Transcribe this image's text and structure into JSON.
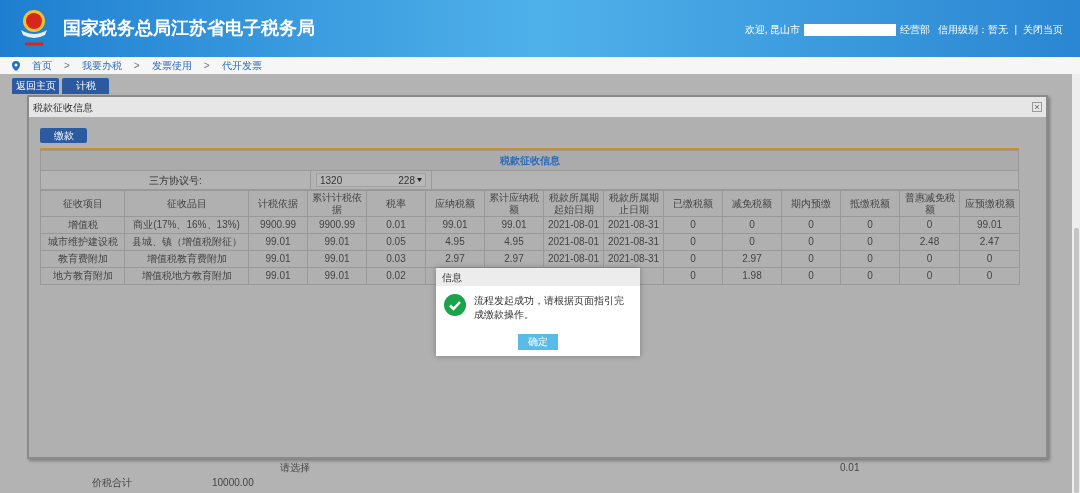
{
  "header": {
    "title": "国家税务总局江苏省电子税务局",
    "user_greeting": "欢迎, 昆山市",
    "user_suffix": "经营部",
    "credit_level": "信用级别：暂无",
    "separator": "|",
    "close_link": "关闭当页"
  },
  "breadcrumb": [
    "首页",
    "我要办税",
    "发票使用",
    "代开发票"
  ],
  "breadcrumb_separator": ">",
  "toolbar": [
    {
      "label": "返回主页"
    },
    {
      "label": "计税"
    }
  ],
  "panel": {
    "title": "税款征收信息",
    "pay_button": "缴款",
    "table": {
      "caption": "税款征收信息",
      "protocol_label": "三方协议号:",
      "protocol_value_parts": [
        "1320",
        "228"
      ],
      "columns": [
        "征收项目",
        "征收品目",
        "计税依据",
        "累计计税依据",
        "税率",
        "应纳税额",
        "累计应纳税额",
        "税款所属期起始日期",
        "税款所属期止日期",
        "已缴税额",
        "减免税额",
        "期内预缴",
        "抵缴税额",
        "普惠减免税额",
        "应预缴税额"
      ],
      "rows": [
        [
          "增值税",
          "商业(17%、16%、13%)",
          "9900.99",
          "9900.99",
          "0.01",
          "99.01",
          "99.01",
          "2021-08-01",
          "2021-08-31",
          "0",
          "0",
          "0",
          "0",
          "0",
          "99.01"
        ],
        [
          "城市维护建设税",
          "县城、镇（增值税附征）",
          "99.01",
          "99.01",
          "0.05",
          "4.95",
          "4.95",
          "2021-08-01",
          "2021-08-31",
          "0",
          "0",
          "0",
          "0",
          "2.48",
          "2.47"
        ],
        [
          "教育费附加",
          "增值税教育费附加",
          "99.01",
          "99.01",
          "0.03",
          "2.97",
          "2.97",
          "2021-08-01",
          "2021-08-31",
          "0",
          "2.97",
          "0",
          "0",
          "0",
          "0"
        ],
        [
          "地方教育附加",
          "增值税地方教育附加",
          "99.01",
          "99.01",
          "0.02",
          null,
          null,
          null,
          null,
          "0",
          "1.98",
          "0",
          "0",
          "0",
          "0"
        ]
      ]
    }
  },
  "background_form": {
    "select_value": "请选择",
    "rate": "0.01",
    "total_label": "价税合计",
    "total_value": "10000.00"
  },
  "dialog": {
    "title": "信息",
    "message": "流程发起成功，请根据页面指引完成缴款操作。",
    "ok_button": "确定"
  }
}
